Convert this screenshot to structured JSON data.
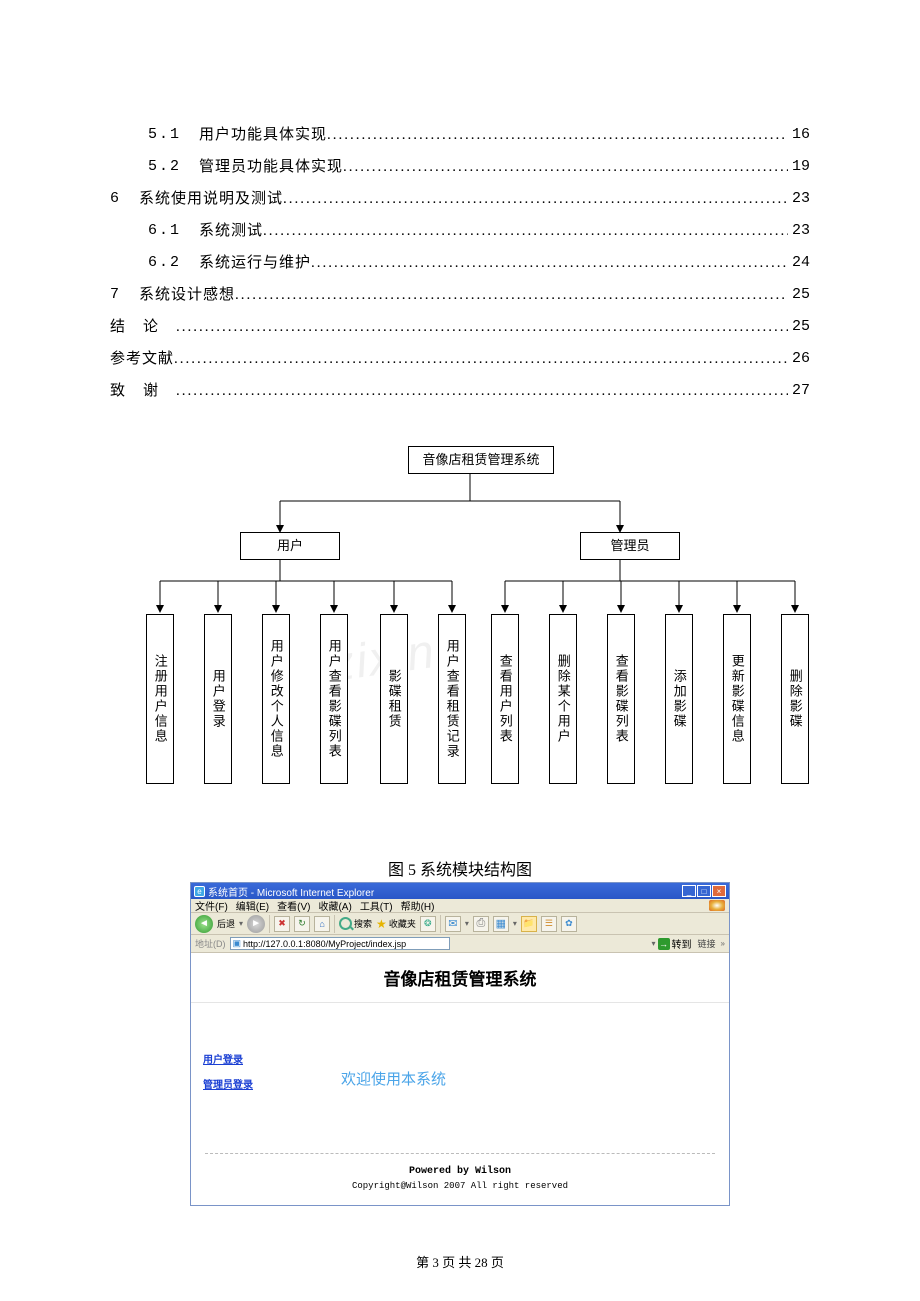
{
  "toc": [
    {
      "indent": 1,
      "num": "5.1",
      "title": "用户功能具体实现",
      "page": "16",
      "spaced": false
    },
    {
      "indent": 1,
      "num": "5.2",
      "title": "管理员功能具体实现",
      "page": "19",
      "spaced": false
    },
    {
      "indent": 0,
      "num": "6",
      "title": "系统使用说明及测试",
      "page": "23",
      "spaced": false
    },
    {
      "indent": 1,
      "num": "6.1",
      "title": "系统测试",
      "page": "23",
      "spaced": false
    },
    {
      "indent": 1,
      "num": "6.2",
      "title": "系统运行与维护",
      "page": "24",
      "spaced": false
    },
    {
      "indent": 0,
      "num": "7",
      "title": "系统设计感想",
      "page": "25",
      "spaced": false
    },
    {
      "indent": 0,
      "num": "",
      "title": "结论",
      "page": "25",
      "spaced": true
    },
    {
      "indent": 0,
      "num": "",
      "title": "参考文献",
      "page": "26",
      "spaced": false
    },
    {
      "indent": 0,
      "num": "",
      "title": "致谢",
      "page": "27",
      "spaced": true
    }
  ],
  "diagram": {
    "root": "音像店租赁管理系统",
    "mid_left": "用户",
    "mid_right": "管理员",
    "leaves_left": [
      "注册用户信息",
      "用户登录",
      "用户修改个人信息",
      "用户查看影碟列表",
      "影碟租赁",
      "用户查看租赁记录"
    ],
    "leaves_right": [
      "查看用户列表",
      "删除某个用户",
      "查看影碟列表",
      "添加影碟",
      "更新影碟信息",
      "删除影碟"
    ]
  },
  "caption": "图 5 系统模块结构图",
  "browser": {
    "title_prefix": "系统首页 - Microsoft Internet Explorer",
    "menus": [
      "文件(F)",
      "编辑(E)",
      "查看(V)",
      "收藏(A)",
      "工具(T)",
      "帮助(H)"
    ],
    "back_label": "后退",
    "search_label": "搜索",
    "fav_label": "收藏夹",
    "addr_label": "地址(D)",
    "addr_value": "http://127.0.0.1:8080/MyProject/index.jsp",
    "go_label": "转到",
    "links_label": "链接",
    "site_title": "音像店租赁管理系统",
    "nav_user": "用户登录",
    "nav_admin": "管理员登录",
    "welcome": "欢迎使用本系统",
    "powered": "Powered by Wilson",
    "copyright": "Copyright@Wilson 2007 All right reserved"
  },
  "page_number": "第 3 页 共 28 页"
}
